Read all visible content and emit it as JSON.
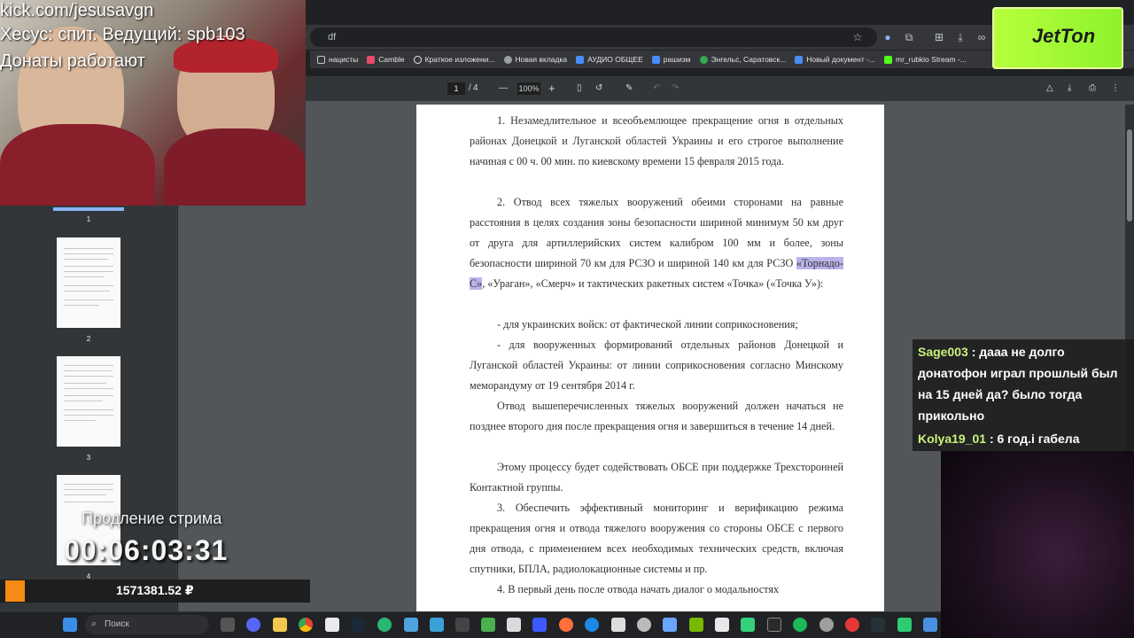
{
  "browser": {
    "url_fragment": "df",
    "bookmarks": [
      {
        "label": "нацисты",
        "color": "#8ab4f8"
      },
      {
        "label": "Camble",
        "color": "#e94b6a"
      },
      {
        "label": "Краткое изложени...",
        "color": "#e8eaed"
      },
      {
        "label": "Новая вкладка",
        "color": "#9aa0a6"
      },
      {
        "label": "АУДИО ОБЩЕЕ",
        "color": "#4a8cf7"
      },
      {
        "label": "рашизм",
        "color": "#4a8cf7"
      },
      {
        "label": "Энгельс, Саратовск...",
        "color": "#34a853"
      },
      {
        "label": "Новый документ -...",
        "color": "#4a8cf7"
      },
      {
        "label": "mr_rubkio Stream -...",
        "color": "#53fc18"
      }
    ]
  },
  "pdf": {
    "current_page": "1",
    "page_sep": "/",
    "total_pages": "4",
    "zoom": "100%",
    "paragraphs": [
      "1. Незамедлительное и всеобъемлющее прекращение огня в отдельных районах Донецкой и Луганской областей Украины и его строгое выполнение начиная с 00 ч. 00 мин. по киевскому времени 15 февраля 2015 года.",
      "2. Отвод всех тяжелых вооружений обеими сторонами на равные расстояния в целях создания зоны безопасности шириной минимум 50 км друг от друга для артиллерийских систем калибром 100 мм и более, зоны безопасности шириной 70 км для РСЗО и шириной 140 км для РСЗО",
      "«Торнадо-С»",
      ", «Ураган», «Смерч» и тактических ракетных систем «Точка» («Точка У»):",
      "- для украинских войск: от фактической линии соприкосновения;",
      "- для вооруженных формирований отдельных районов Донецкой и Луганской областей Украины: от линии соприкосновения согласно Минскому меморандуму от 19 сентября 2014 г.",
      "Отвод вышеперечисленных тяжелых вооружений должен начаться не позднее второго дня после прекращения огня и завершиться в течение 14 дней.",
      "Этому процессу будет содействовать ОБСЕ при поддержке Трехсторонней Контактной группы.",
      "3. Обеспечить эффективный мониторинг и верификацию режима прекращения огня и отвода тяжелого вооружения со стороны ОБСЕ с первого дня отвода, с применением всех необходимых технических средств, включая спутники, БПЛА, радиолокационные системы и пр.",
      "4. В первый день после отвода начать диалог о модальностях"
    ],
    "thumbnails": [
      "1",
      "2",
      "3",
      "4"
    ]
  },
  "stream": {
    "channel": "kick.com/jesusavgn",
    "line2": "Хесус: спит. Ведущий: spb1",
    "line2_tail": "03",
    "line3": "Донаты работают",
    "extend_label": "Продление стрима",
    "timer": "00:06:03:31",
    "donate_amount": "1571381.52 ₽",
    "logo_text": "JetTon"
  },
  "chat": [
    {
      "user": "Sage003",
      "text": " : дааа не долго донатофон играл прошлый был на 15 дней да? было тогда прикольно"
    },
    {
      "user": "Kolya19_01",
      "text": " : 6 год.і габела"
    }
  ],
  "taskbar": {
    "search_placeholder": "Поиск"
  }
}
